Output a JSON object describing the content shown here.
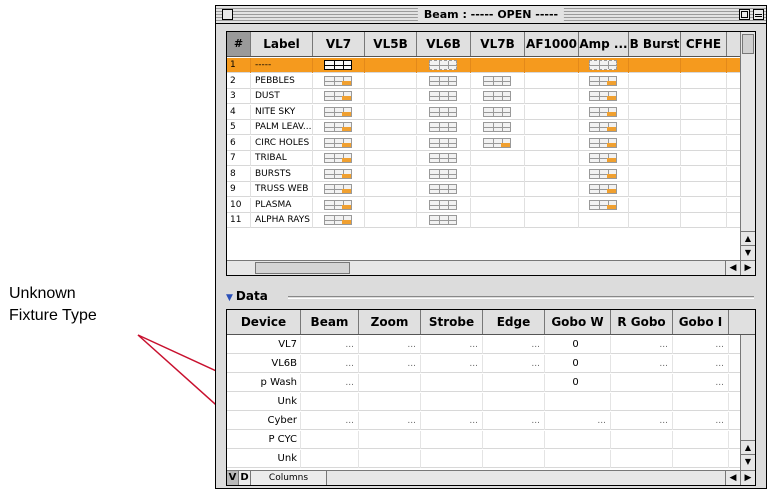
{
  "annotation": {
    "line1": "Unknown",
    "line2": "Fixture Type"
  },
  "window": {
    "title": "Beam : ----- OPEN -----"
  },
  "top_grid": {
    "columns": [
      "#",
      "Label",
      "VL7",
      "VL5B",
      "VL6B",
      "VL7B",
      "AF1000",
      "Amp ...",
      "B Burst",
      "CFHE"
    ],
    "rows": [
      {
        "num": "1",
        "label": "-----",
        "selected": true
      },
      {
        "num": "2",
        "label": "PEBBLES"
      },
      {
        "num": "3",
        "label": "DUST"
      },
      {
        "num": "4",
        "label": "NITE SKY"
      },
      {
        "num": "5",
        "label": "PALM LEAV..."
      },
      {
        "num": "6",
        "label": "CIRC HOLES"
      },
      {
        "num": "7",
        "label": "TRIBAL"
      },
      {
        "num": "8",
        "label": "BURSTS"
      },
      {
        "num": "9",
        "label": "TRUSS WEB"
      },
      {
        "num": "10",
        "label": "PLASMA"
      },
      {
        "num": "11",
        "label": "ALPHA RAYS"
      }
    ]
  },
  "data_section": {
    "label": "Data",
    "columns": [
      "Device",
      "Beam",
      "Zoom",
      "Strobe",
      "Edge",
      "Gobo W",
      "R Gobo",
      "Gobo I"
    ],
    "rows": [
      {
        "device": "VL7",
        "values": [
          "...",
          "...",
          "...",
          "...",
          "0",
          "...",
          "..."
        ]
      },
      {
        "device": "VL6B",
        "values": [
          "...",
          "...",
          "...",
          "...",
          "0",
          "...",
          "..."
        ]
      },
      {
        "device": "p Wash",
        "values": [
          "...",
          "",
          "",
          "",
          "0",
          "",
          "..."
        ]
      },
      {
        "device": "Unk",
        "values": [
          "",
          "",
          "",
          "",
          "",
          "",
          ""
        ]
      },
      {
        "device": "Cyber",
        "values": [
          "...",
          "...",
          "...",
          "...",
          "...",
          "...",
          "..."
        ]
      },
      {
        "device": "P CYC",
        "values": [
          "",
          "",
          "",
          "",
          "",
          "",
          ""
        ]
      },
      {
        "device": "Unk",
        "values": [
          "",
          "",
          "",
          "",
          "",
          "",
          ""
        ]
      }
    ],
    "tabs": {
      "v": "V",
      "d": "D",
      "columns": "Columns"
    }
  },
  "colors": {
    "selection": "#f59a1e",
    "arrow": "#c8102e",
    "accent": "#2a4fb8"
  }
}
